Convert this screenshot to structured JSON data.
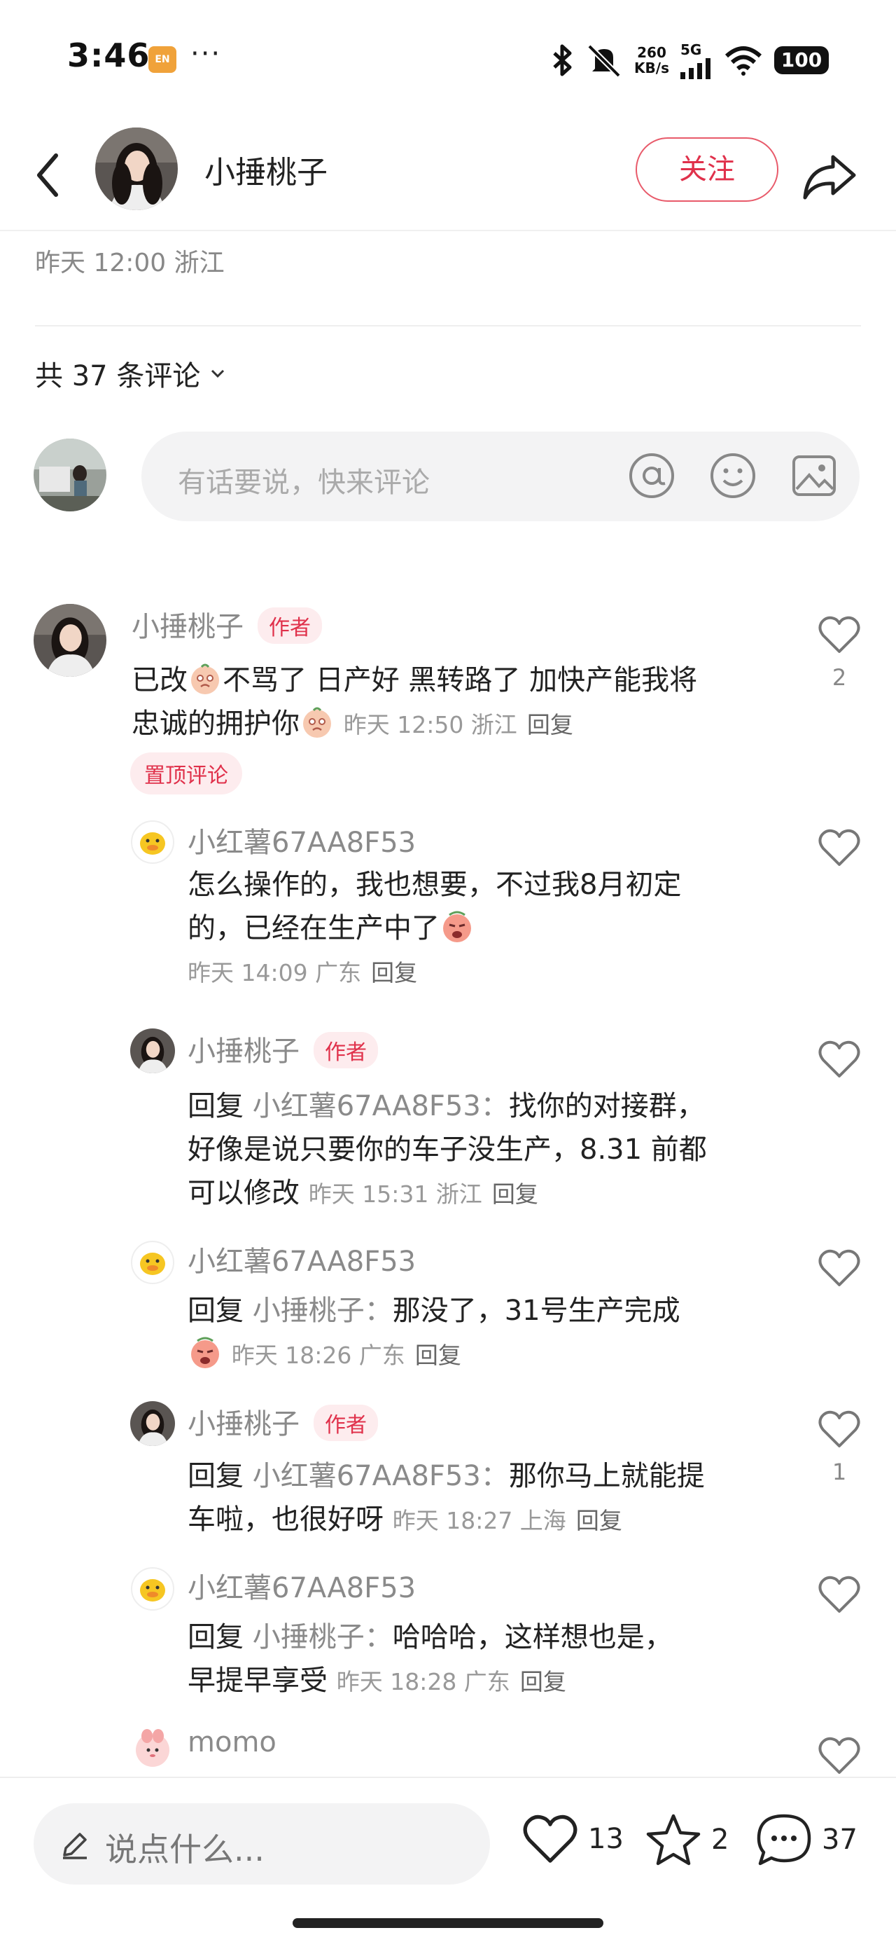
{
  "status_bar": {
    "time": "3:46",
    "badge": "EN",
    "dots": "···",
    "speed_value": "260",
    "speed_unit": "KB/s",
    "network": "5G",
    "battery": "100"
  },
  "header": {
    "author_name": "小捶桃子",
    "follow_label": "关注"
  },
  "post": {
    "meta": "昨天 12:00 浙江"
  },
  "comments_section": {
    "count_label": "共 37 条评论",
    "compose_placeholder": "有话要说，快来评论"
  },
  "colors": {
    "accent": "#e0314b",
    "tag_bg": "#fdecee",
    "input_bg": "#f3f3f4"
  },
  "comments": [
    {
      "name": "小捶桃子",
      "tag": "作者",
      "text_a": "已改",
      "text_b": "不骂了 日产好 黑转路了 加快产能我将",
      "text_c": "忠诚的拥护你",
      "meta": "昨天 12:50 浙江",
      "reply": "回复",
      "likes": "2",
      "pinned": "置顶评论",
      "avatar": "woman-avatar"
    },
    {
      "name": "小红薯67AA8F53",
      "line1": "怎么操作的，我也想要，不过我8月初定",
      "line2": "的，已经在生产中了",
      "meta": "昨天 14:09 广东",
      "reply": "回复",
      "avatar": "duck-avatar"
    },
    {
      "name": "小捶桃子",
      "tag": "作者",
      "prefix": "回复",
      "target": "小红薯67AA8F53：",
      "line1": "找你的对接群，",
      "line2": "好像是说只要你的车子没生产，8.31 前都",
      "line3": "可以修改",
      "meta": "昨天 15:31 浙江",
      "reply": "回复",
      "avatar": "woman-avatar"
    },
    {
      "name": "小红薯67AA8F53",
      "prefix": "回复",
      "target": "小捶桃子：",
      "line1": "那没了，31号生产完成",
      "meta": "昨天 18:26 广东",
      "reply": "回复",
      "avatar": "duck-avatar"
    },
    {
      "name": "小捶桃子",
      "tag": "作者",
      "prefix": "回复",
      "target": "小红薯67AA8F53：",
      "line1": "那你马上就能提",
      "line2": "车啦，也很好呀",
      "meta": "昨天 18:27 上海",
      "reply": "回复",
      "likes": "1",
      "avatar": "woman-avatar"
    },
    {
      "name": "小红薯67AA8F53",
      "prefix": "回复",
      "target": "小捶桃子：",
      "line1": "哈哈哈，这样想也是，",
      "line2": "早提早享受",
      "meta": "昨天 18:28 广东",
      "reply": "回复",
      "avatar": "duck-avatar"
    },
    {
      "name": "momo",
      "avatar": "pink-character-avatar"
    }
  ],
  "bottom_bar": {
    "placeholder": "说点什么...",
    "likes": "13",
    "stars": "2",
    "comments": "37"
  }
}
